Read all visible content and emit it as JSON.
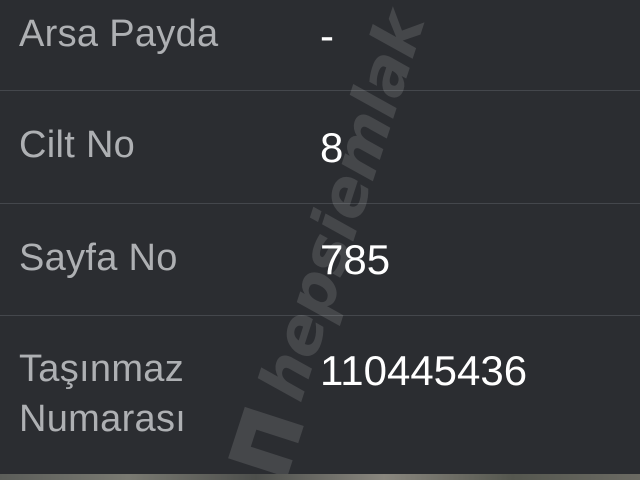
{
  "details": {
    "rows": [
      {
        "label": "Arsa Payda",
        "value": "-"
      },
      {
        "label": "Cilt No",
        "value": "8"
      },
      {
        "label": "Sayfa No",
        "value": "785"
      },
      {
        "label": "Taşınmaz",
        "label2": "Numarası",
        "value": "110445436"
      }
    ]
  },
  "watermark": {
    "text": "hepsiemlak"
  },
  "colors": {
    "background": "#2b2d31",
    "divider": "#44474c",
    "label": "#aeb0b3",
    "value": "#ffffff"
  }
}
